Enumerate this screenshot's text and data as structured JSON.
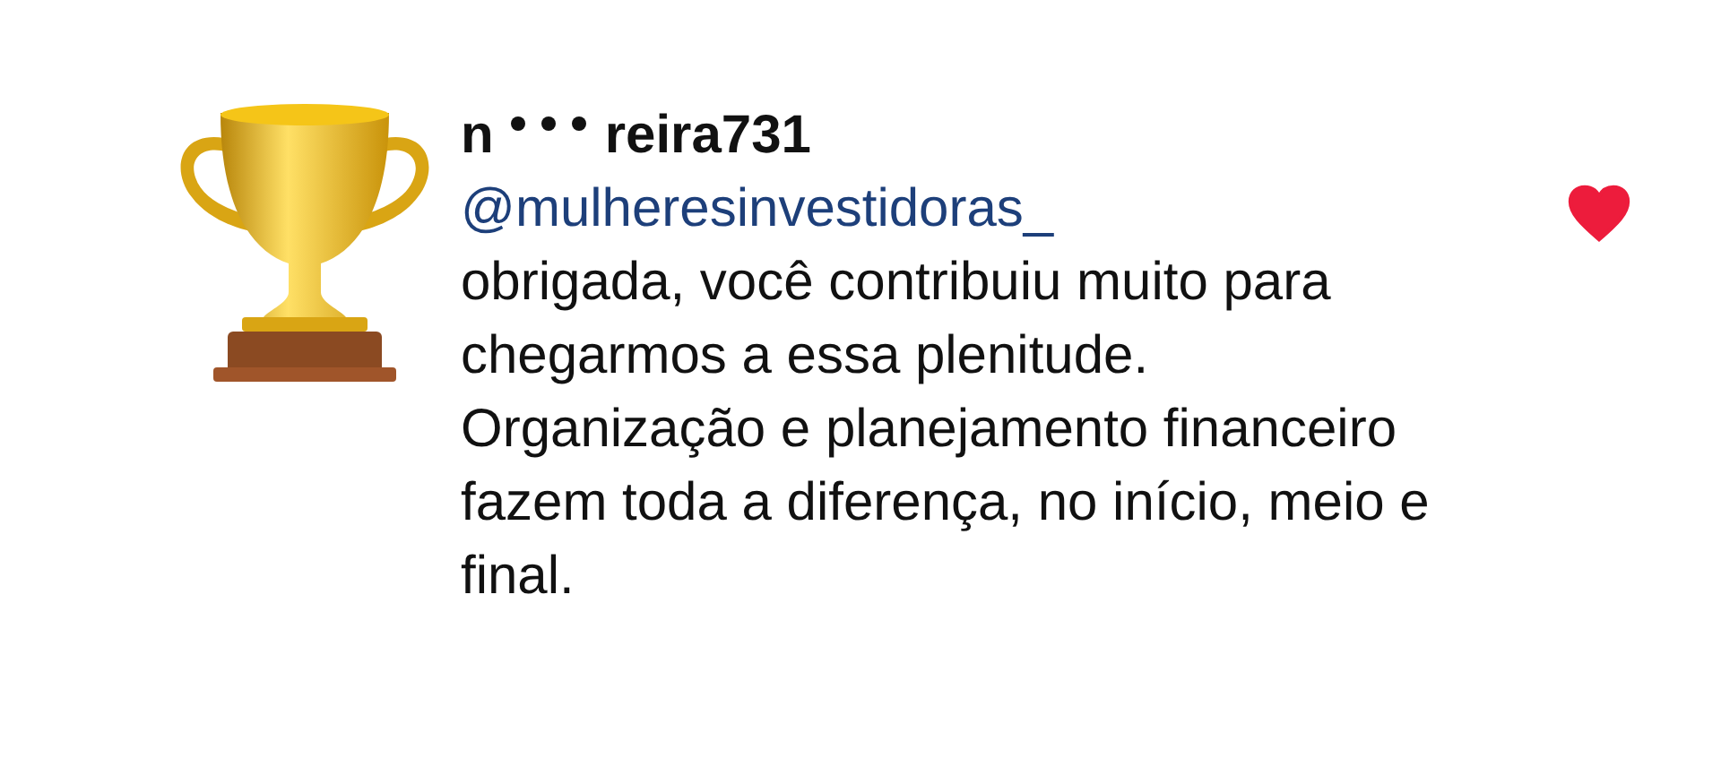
{
  "comment": {
    "username_start": "n",
    "username_end": "reira731",
    "mention": "@mulheresinvestidoras_",
    "text": "obrigada, você contribuiu muito para chegarmos a essa plenitude. Organização e planejamento financeiro fazem toda a diferença, no início, meio e final.",
    "liked": true
  }
}
